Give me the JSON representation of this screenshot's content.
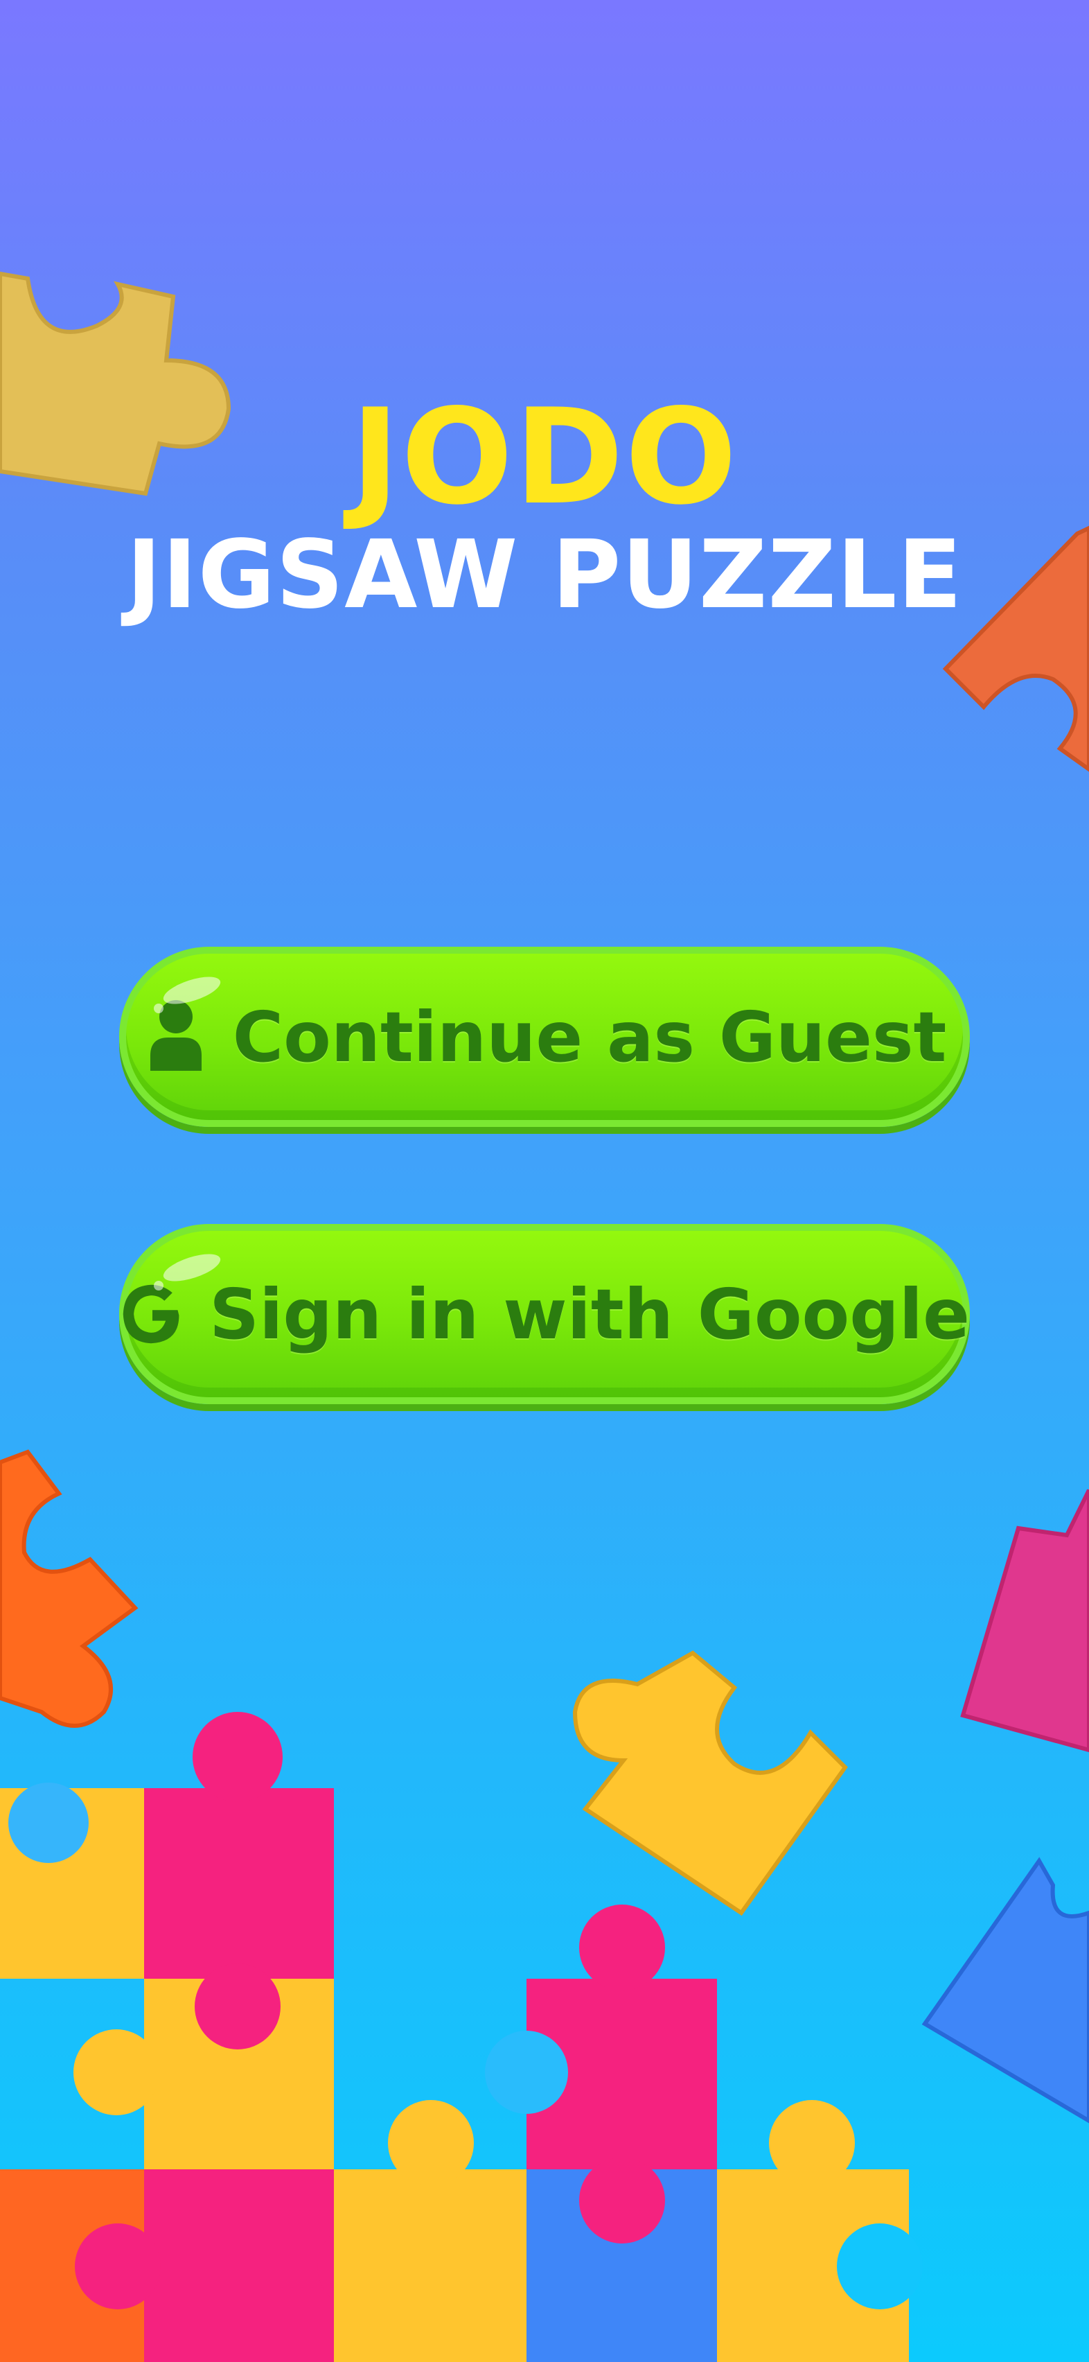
{
  "app": {
    "title_main": "JODO",
    "title_sub": "JIGSAW PUZZLE"
  },
  "buttons": {
    "guest": {
      "label": "Continue as Guest",
      "icon": "person-icon"
    },
    "google": {
      "label": "Sign in with Google",
      "icon": "google-g-icon"
    }
  },
  "colors": {
    "title_main": "#ffe61c",
    "title_sub": "#ffffff",
    "button_fill": "#7ae80a",
    "button_text": "#2b7d0f",
    "piece_yellow": "#ffc52e",
    "piece_pink": "#f5227f",
    "piece_orange": "#ff6622",
    "piece_blue": "#3f86f8",
    "piece_magenta": "#e0378e"
  }
}
